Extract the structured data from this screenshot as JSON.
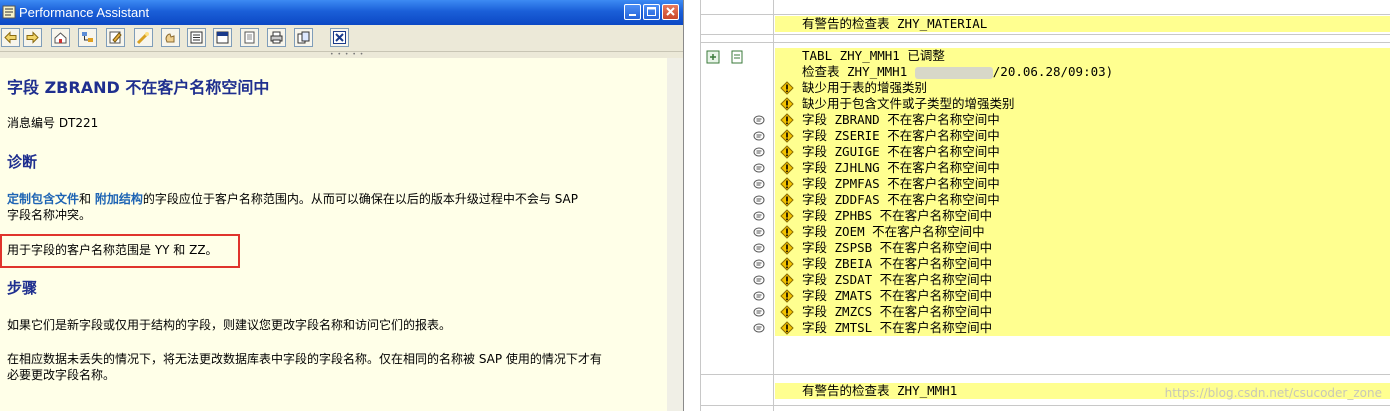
{
  "window": {
    "title": "Performance Assistant",
    "toolbar_icons": [
      "back-icon",
      "forward-icon",
      "home-icon",
      "structure-icon",
      "edit-icon",
      "find-icon",
      "hand-icon",
      "book-icon",
      "bookmark-icon",
      "print-preview-icon",
      "print-icon",
      "copy-icon",
      "exit-icon"
    ]
  },
  "doc": {
    "title": "字段 ZBRAND 不在客户名称空间中",
    "message_no": "消息编号 DT221",
    "section_diag": "诊断",
    "diag_link1": "定制包含文件",
    "diag_and": "和",
    "diag_link2": "附加结构",
    "diag_rest": "的字段应位于客户名称范围内。从而可以确保在以后的版本升级过程中不会与 SAP",
    "diag_line2": "字段名称冲突。",
    "range_line": "用于字段的客户名称范围是 YY 和 ZZ。",
    "section_steps": "步骤",
    "steps_p1": "如果它们是新字段或仅用于结构的字段，则建议您更改字段名称和访问它们的报表。",
    "steps_p2_l1": "在相应数据未丢失的情况下，将无法更改数据库表中字段的字段名称。仅在相同的名称被 SAP 使用的情况下才有",
    "steps_p2_l2": "必要更改字段名称。"
  },
  "log": {
    "header_top": "有警告的检查表 ZHY_MATERIAL",
    "tabl_line": "TABL ZHY_MMH1 已调整",
    "check_line_prefix": "检查表 ZHY_MMH1",
    "check_line_suffix": "/20.06.28/09:03)",
    "rows": [
      {
        "text": "缺少用于表的增强类别",
        "msg": false
      },
      {
        "text": "缺少用于包含文件或子类型的增强类别",
        "msg": false
      },
      {
        "text": "字段 ZBRAND 不在客户名称空间中",
        "msg": true
      },
      {
        "text": "字段 ZSERIE 不在客户名称空间中",
        "msg": true
      },
      {
        "text": "字段 ZGUIGE 不在客户名称空间中",
        "msg": true
      },
      {
        "text": "字段 ZJHLNG 不在客户名称空间中",
        "msg": true
      },
      {
        "text": "字段 ZPMFAS 不在客户名称空间中",
        "msg": true
      },
      {
        "text": "字段 ZDDFAS 不在客户名称空间中",
        "msg": true
      },
      {
        "text": "字段 ZPHBS 不在客户名称空间中",
        "msg": true
      },
      {
        "text": "字段 ZOEM 不在客户名称空间中",
        "msg": true
      },
      {
        "text": "字段 ZSPSB 不在客户名称空间中",
        "msg": true
      },
      {
        "text": "字段 ZBEIA 不在客户名称空间中",
        "msg": true
      },
      {
        "text": "字段 ZSDAT 不在客户名称空间中",
        "msg": true
      },
      {
        "text": "字段 ZMATS 不在客户名称空间中",
        "msg": true
      },
      {
        "text": "字段 ZMZCS 不在客户名称空间中",
        "msg": true
      },
      {
        "text": "字段 ZMTSL 不在客户名称空间中",
        "msg": true
      }
    ],
    "header_bottom": "有警告的检查表 ZHY_MMH1",
    "watermark": "https://blog.csdn.net/csucoder_zone"
  },
  "colors": {
    "highlight": "#ffff90",
    "title_blue": "#1f2f8f",
    "link_blue": "#1e64b4",
    "red_box": "#e0342c"
  }
}
